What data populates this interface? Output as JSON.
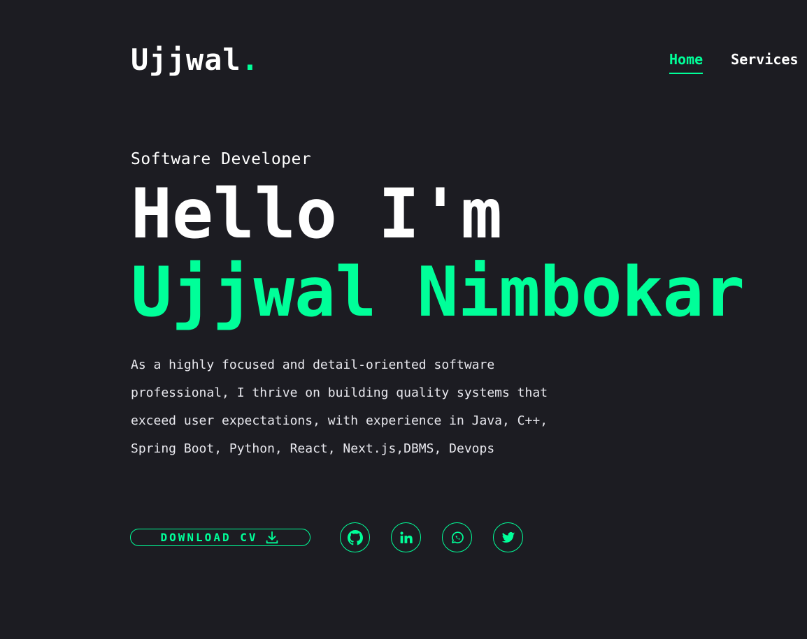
{
  "header": {
    "logo_text": "Ujjwal",
    "logo_dot": ".",
    "nav": [
      {
        "label": "Home",
        "active": true
      },
      {
        "label": "Services",
        "active": false
      }
    ]
  },
  "hero": {
    "role": "Software Developer",
    "greeting": "Hello I'm",
    "name": "Ujjwal Nimbokar",
    "description": "As a highly focused and detail-oriented software professional, I thrive on building quality systems that exceed user expectations, with experience in Java, C++, Spring Boot, Python, React, Next.js,DBMS, Devops"
  },
  "actions": {
    "cv_label": "DOWNLOAD CV",
    "cv_icon": "download-icon",
    "social": [
      {
        "icon": "github-icon"
      },
      {
        "icon": "linkedin-icon"
      },
      {
        "icon": "whatsapp-icon"
      },
      {
        "icon": "twitter-icon"
      }
    ]
  },
  "colors": {
    "accent": "#00ff99",
    "background": "#1c1c22",
    "text": "#ffffff"
  }
}
